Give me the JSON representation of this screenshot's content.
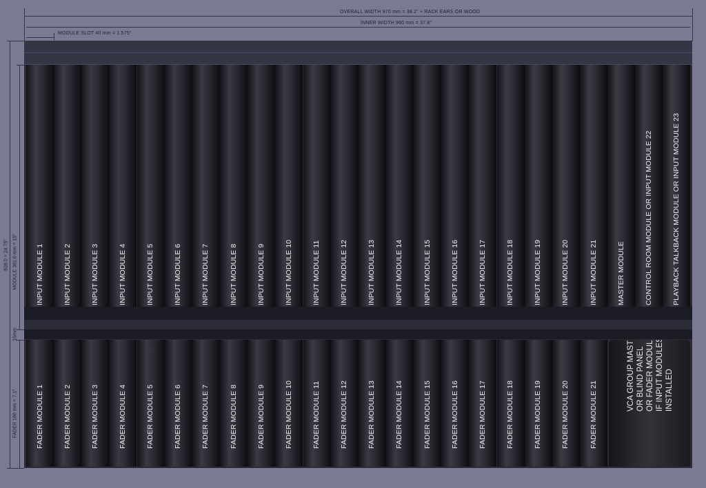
{
  "dimensions": {
    "overall_width": "OVERALL WIDTH 970 mm = 38.2\" + RACK EARS OR WOOD",
    "inner_width": "INNER WIDTH 960 mm = 37.8\"",
    "module_slot": "MODULE SLOT 40 mm = 1.575\"",
    "total_height": "628.0 = 24.75\"",
    "module_height": "MODULE 381.0 mm = 15\"",
    "gap": "15mm",
    "fader_height": "FADER 180 mm = 7.1\""
  },
  "input_modules": [
    "INPUT MODULE 1",
    "INPUT MODULE 2",
    "INPUT MODULE 3",
    "INPUT MODULE 4",
    "INPUT MODULE 5",
    "INPUT MODULE 6",
    "INPUT MODULE 7",
    "INPUT MODULE 8",
    "INPUT MODULE 9",
    "INPUT MODULE 10",
    "INPUT MODULE 11",
    "INPUT MODULE 12",
    "INPUT MODULE 13",
    "INPUT MODULE 14",
    "INPUT MODULE 15",
    "INPUT MODULE 16",
    "INPUT MODULE 17",
    "INPUT MODULE 18",
    "INPUT MODULE 19",
    "INPUT MODULE 20",
    "INPUT MODULE 21",
    "MASTER MODULE",
    "CONTROL ROOM MODULE OR INPUT MODULE 22",
    "PLAYBACK TALKBACK MODULE OR INPUT MODULE 23"
  ],
  "fader_modules": [
    "FADER MODULE 1",
    "FADER MODULE 2",
    "FADER MODULE 3",
    "FADER MODULE 4",
    "FADER MODULE 5",
    "FADER MODULE 6",
    "FADER MODULE 7",
    "FADER MODULE 8",
    "FADER MODULE 9",
    "FADER MODULE 10",
    "FADER MODULE 11",
    "FADER MODULE 12",
    "FADER MODULE 13",
    "FADER MODULE 14",
    "FADER MODULE 15",
    "FADER MODULE 16",
    "FADER MODULE 17",
    "FADER MODULE 18",
    "FADER MODULE 19",
    "FADER MODULE 20",
    "FADER MODULE 21"
  ],
  "vca_panel": {
    "lines": [
      "VCA GROUP MASTER",
      "OR BLIND PANEL",
      "OR FADER MODULES",
      "IF INPUT MODULES ARE",
      "INSTALLED"
    ]
  },
  "colors": {
    "background": "#7a7b93",
    "module_dark": "#131318",
    "module_light": "#3a3a44",
    "label": "#ececf2"
  }
}
